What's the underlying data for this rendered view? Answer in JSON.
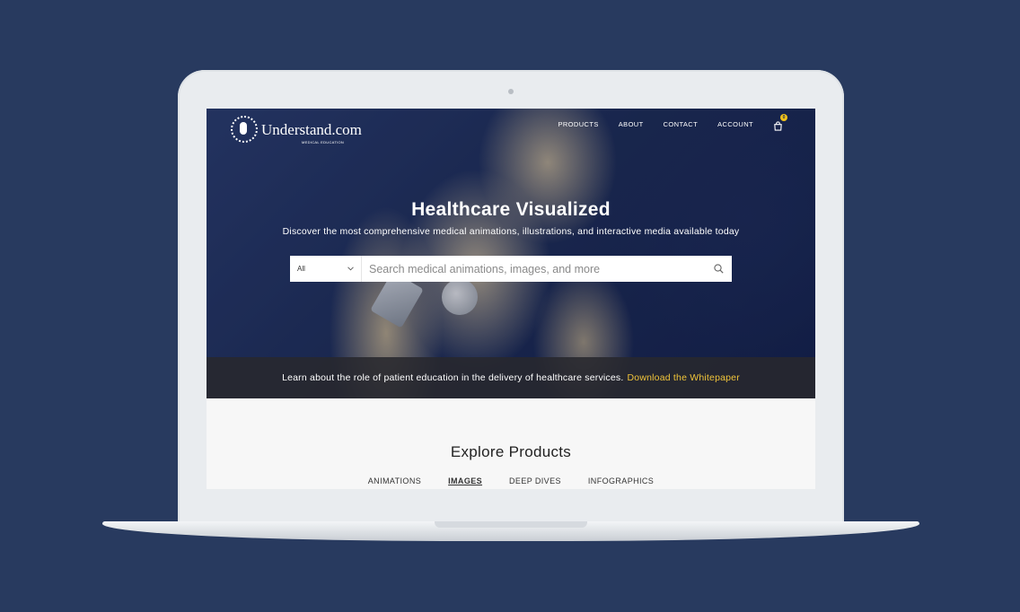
{
  "site": {
    "logo_text": "Understand.com",
    "logo_sub": "MEDICAL EDUCATION"
  },
  "nav": {
    "items": [
      {
        "label": "PRODUCTS"
      },
      {
        "label": "ABOUT"
      },
      {
        "label": "CONTACT"
      },
      {
        "label": "ACCOUNT"
      }
    ],
    "cart_icon": "shopping-bag-icon",
    "cart_count": "0"
  },
  "hero": {
    "title": "Healthcare Visualized",
    "subtitle": "Discover the most comprehensive medical animations, illustrations, and interactive media available today"
  },
  "search": {
    "category_selected": "All",
    "placeholder": "Search medical animations, images, and more",
    "icon": "search-icon"
  },
  "banner": {
    "text": "Learn about the role of patient education in the delivery of healthcare services.",
    "link_label": "Download the Whitepaper",
    "link_color": "#f0c43a"
  },
  "explore": {
    "title": "Explore Products",
    "tabs": [
      {
        "label": "ANIMATIONS",
        "active": false
      },
      {
        "label": "IMAGES",
        "active": true
      },
      {
        "label": "DEEP DIVES",
        "active": false
      },
      {
        "label": "INFOGRAPHICS",
        "active": false
      }
    ]
  },
  "colors": {
    "background": "#283a5f",
    "accent": "#f2c21a"
  }
}
